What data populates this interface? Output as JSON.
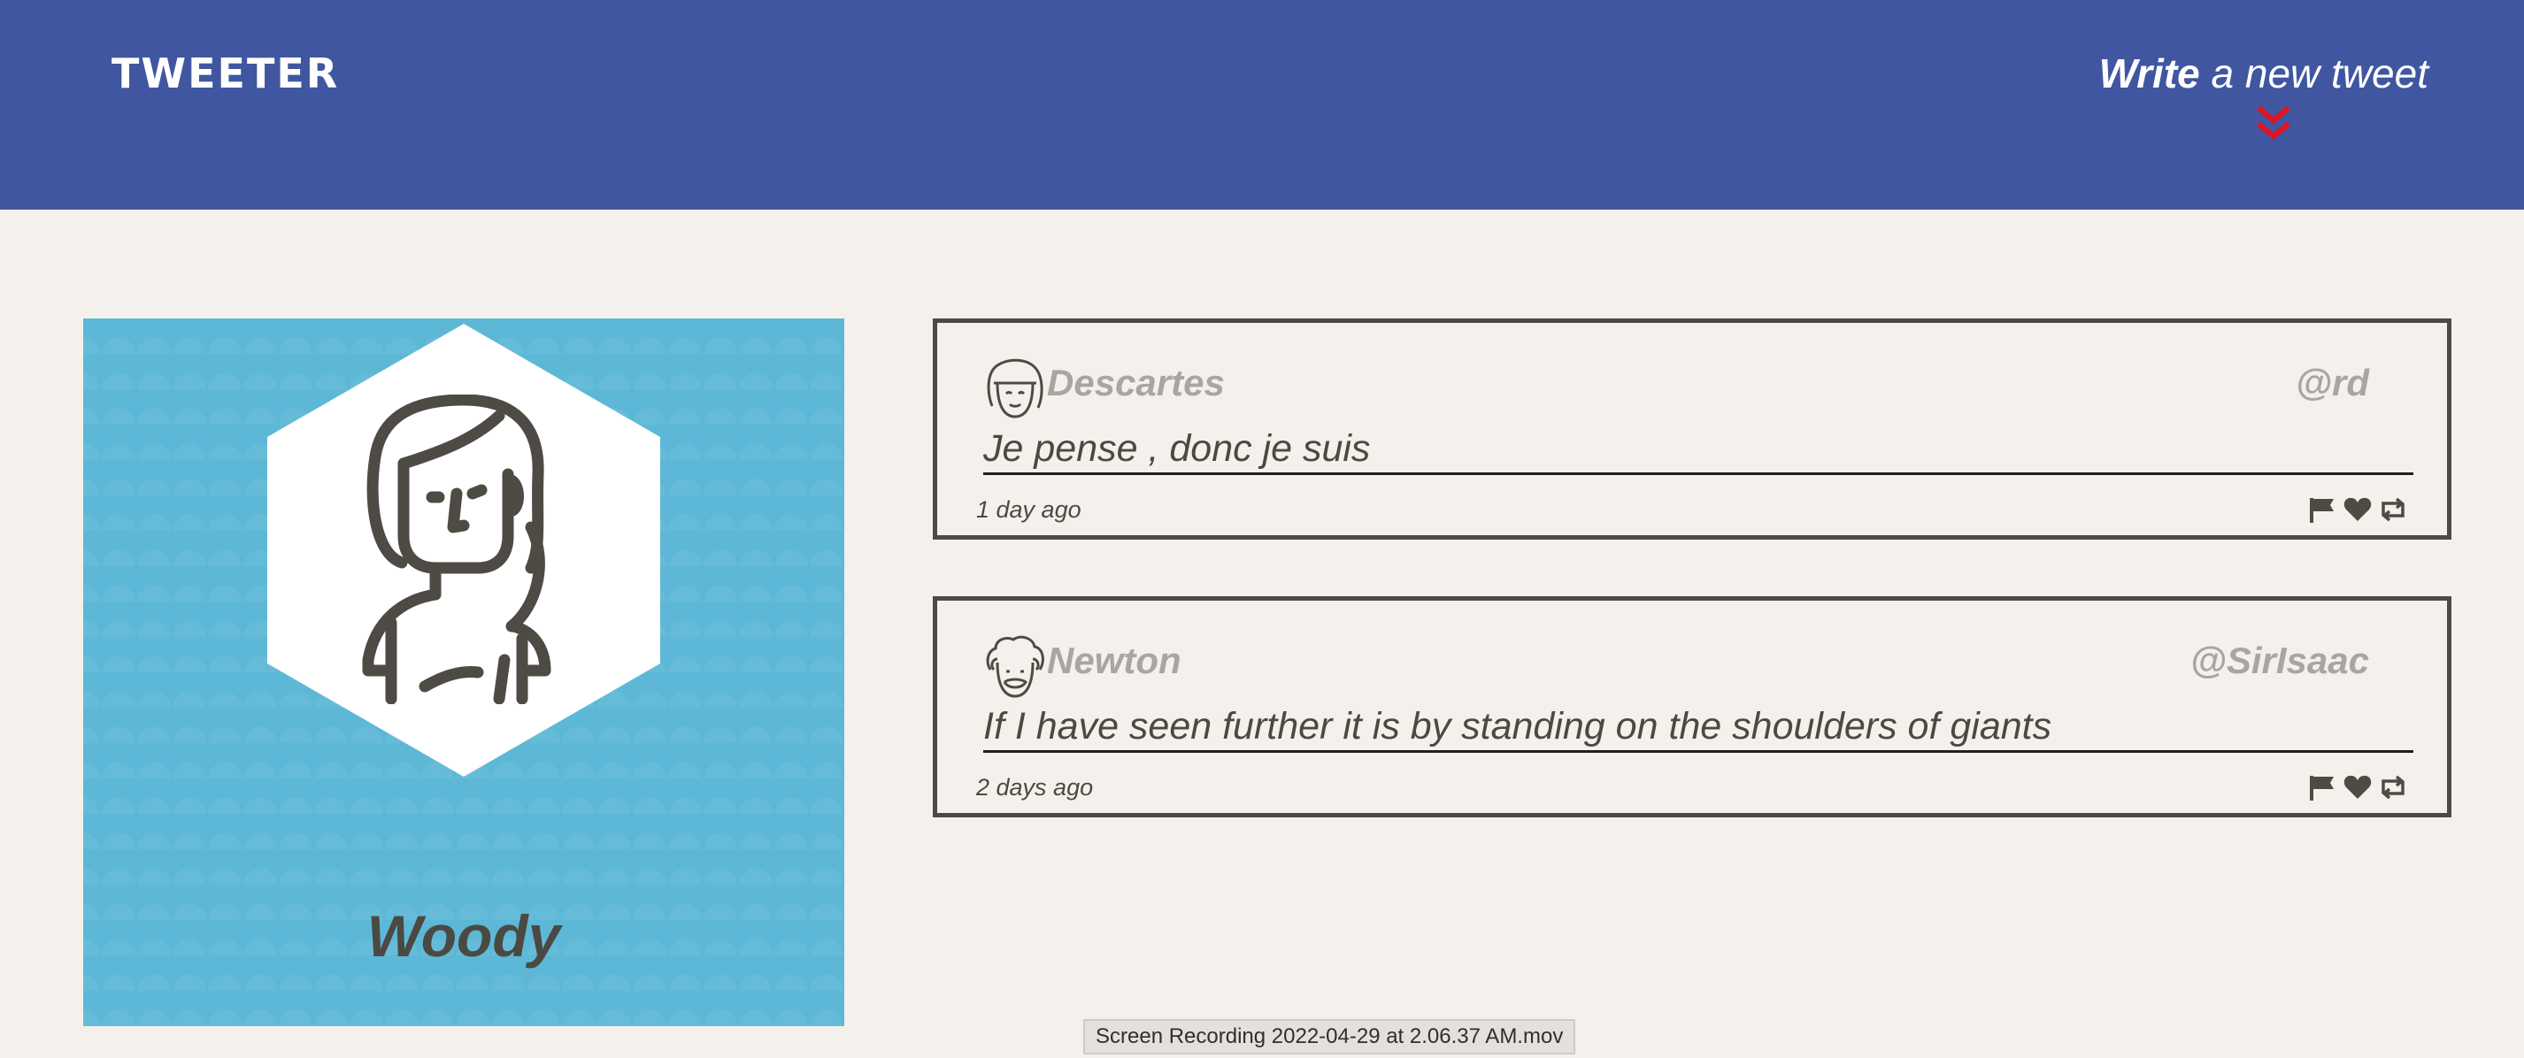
{
  "header": {
    "brand": "TWEETER",
    "compose_strong": "Write",
    "compose_rest": " a new tweet",
    "accent_color": "#4056a1",
    "chevron_color": "#e0141e"
  },
  "profile": {
    "name": "Woody",
    "background_color": "#5cb8d6"
  },
  "tweets": [
    {
      "name": "Descartes",
      "handle": "@rd",
      "content": "Je pense , donc je suis",
      "time": "1 day ago",
      "avatar_icon": "bangs-face-icon"
    },
    {
      "name": "Newton",
      "handle": "@SirIsaac",
      "content": "If I have seen further it is by standing on the shoulders of giants",
      "time": "2 days ago",
      "avatar_icon": "curly-hair-face-icon"
    }
  ],
  "tweet_actions": [
    "flag-icon",
    "heart-icon",
    "retweet-icon"
  ],
  "footer": {
    "recording_label": "Screen Recording 2022-04-29 at 2.06.37 AM.mov"
  }
}
